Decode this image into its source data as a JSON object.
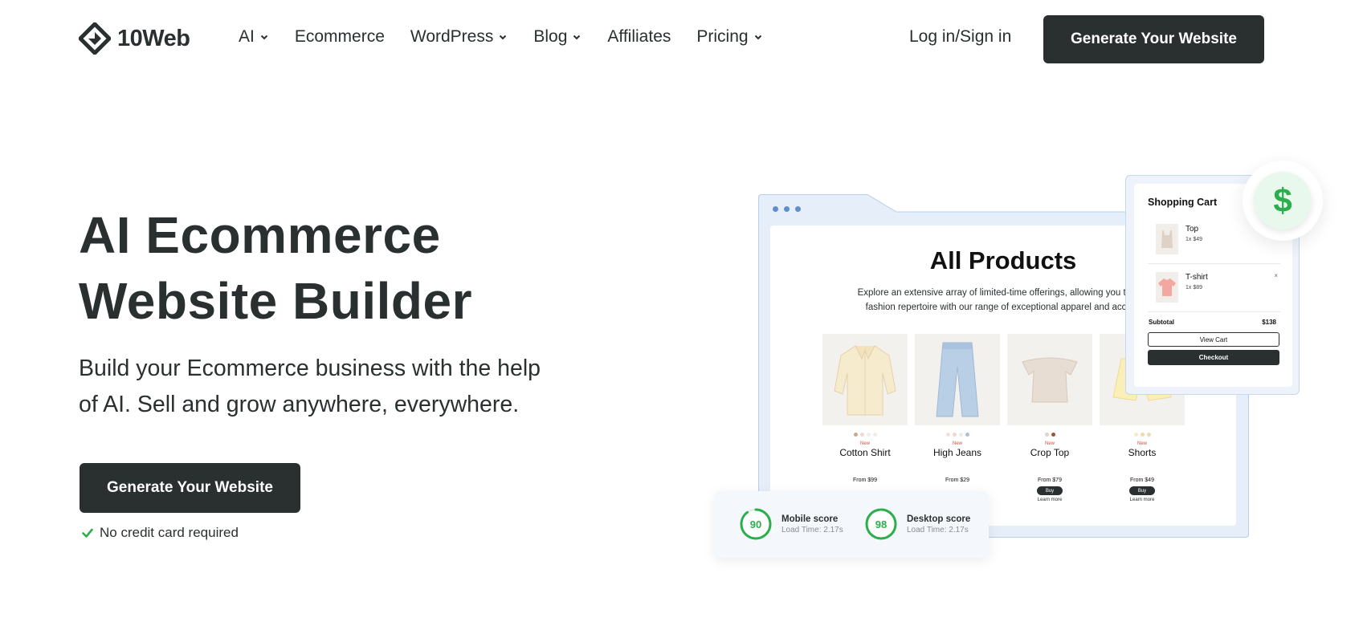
{
  "brand": {
    "name": "10Web"
  },
  "nav": {
    "items": [
      {
        "label": "AI",
        "dropdown": true
      },
      {
        "label": "Ecommerce",
        "dropdown": false
      },
      {
        "label": "WordPress",
        "dropdown": true
      },
      {
        "label": "Blog",
        "dropdown": true
      },
      {
        "label": "Affiliates",
        "dropdown": false
      },
      {
        "label": "Pricing",
        "dropdown": true
      }
    ],
    "login": "Log in/Sign in",
    "cta": "Generate Your Website"
  },
  "hero": {
    "title_line1": "AI Ecommerce",
    "title_line2": "Website Builder",
    "subtitle_line1": "Build your Ecommerce business with the help",
    "subtitle_line2": "of AI. Sell and grow anywhere, everywhere.",
    "cta": "Generate Your Website",
    "note": "No credit card required"
  },
  "mock_store": {
    "title": "All Products",
    "desc_line1": "Explore an extensive array of limited-time offerings, allowing you to enh",
    "desc_line2": "fashion repertoire with our range of exceptional apparel and access",
    "products": [
      {
        "name": "Cotton Shirt",
        "tag": "New",
        "price": "From $99",
        "buy": "",
        "learn": ""
      },
      {
        "name": "High Jeans",
        "tag": "New",
        "price": "From $29",
        "buy": "",
        "learn": ""
      },
      {
        "name": "Crop Top",
        "tag": "New",
        "price": "From $79",
        "buy": "Buy",
        "learn": "Learn more"
      },
      {
        "name": "Shorts",
        "tag": "New",
        "price": "From $49",
        "buy": "Buy",
        "learn": "Learn more"
      }
    ]
  },
  "cart": {
    "title": "Shopping Cart",
    "items": [
      {
        "name": "Top",
        "qty": "1x $49"
      },
      {
        "name": "T-shirt",
        "qty": "1x $89"
      }
    ],
    "subtotal_label": "Subtotal",
    "subtotal_value": "$138",
    "view_cart": "View Cart",
    "checkout": "Checkout",
    "badge": "$"
  },
  "scores": {
    "mobile": {
      "value": "90",
      "label": "Mobile score",
      "load": "Load Time: 2.17s",
      "fraction": 0.9
    },
    "desktop": {
      "value": "98",
      "label": "Desktop score",
      "load": "Load Time: 2.17s",
      "fraction": 0.98
    }
  },
  "colors": {
    "dark": "#2a2f30",
    "accent_green": "#2cae4c",
    "mock_blue": "#5e8ecb",
    "mock_frame_bg": "#e6eef9"
  }
}
